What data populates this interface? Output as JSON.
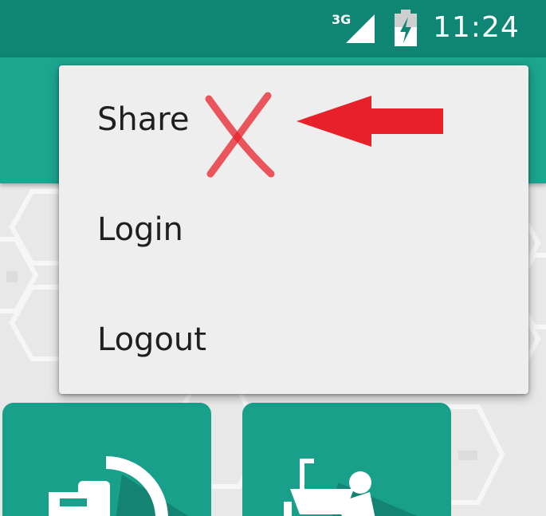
{
  "status_bar": {
    "network_label": "3G",
    "time": "11:24",
    "network_icon": "cellular-signal-icon",
    "battery_icon": "battery-charging-icon"
  },
  "menu": {
    "items": [
      {
        "label": "Share"
      },
      {
        "label": "Login"
      },
      {
        "label": "Logout"
      }
    ]
  },
  "tiles": [
    {
      "icon": "power-plug-icon"
    },
    {
      "icon": "plumber-icon"
    }
  ],
  "annotations": {
    "cross_mark_icon": "red-x-mark-icon",
    "arrow_icon": "red-arrow-left-icon"
  },
  "colors": {
    "status_bar": "#0f8574",
    "toolbar": "#1ca58f",
    "tile": "#18a08b",
    "menu_background": "#eeeeee",
    "menu_text": "#1f1f1f",
    "annotation_red": "#e8202a"
  }
}
